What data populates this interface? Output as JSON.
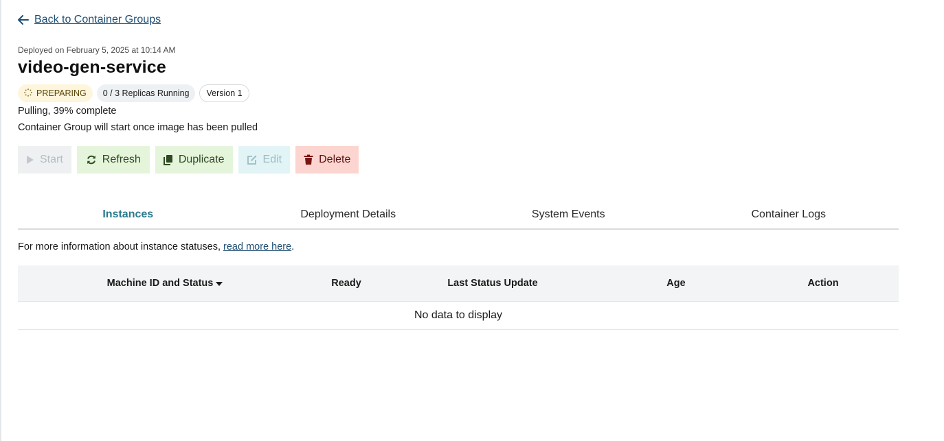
{
  "back_link": {
    "label": "Back to Container Groups"
  },
  "header": {
    "deployed": "Deployed on February 5, 2025 at 10:14 AM",
    "title": "video-gen-service"
  },
  "badges": {
    "status": "PREPARING",
    "replicas": "0 / 3 Replicas Running",
    "version": "Version 1"
  },
  "status_text": {
    "pulling": "Pulling, 39% complete",
    "note": "Container Group will start once image has been pulled"
  },
  "actions": {
    "start": "Start",
    "refresh": "Refresh",
    "duplicate": "Duplicate",
    "edit": "Edit",
    "delete": "Delete"
  },
  "tabs": [
    {
      "label": "Instances",
      "active": true
    },
    {
      "label": "Deployment Details",
      "active": false
    },
    {
      "label": "System Events",
      "active": false
    },
    {
      "label": "Container Logs",
      "active": false
    }
  ],
  "info": {
    "prefix": "For more information about instance statuses, ",
    "link": "read more here",
    "suffix": "."
  },
  "table": {
    "columns": [
      "Machine ID and Status",
      "Ready",
      "Last Status Update",
      "Age",
      "Action"
    ],
    "empty_message": "No data to display"
  },
  "colors": {
    "accent": "#2a7a8f",
    "link": "#1f4e73",
    "preparing_bg": "#fdf6dc",
    "success_bg": "#e5f5dc",
    "danger_bg": "#fdd5d0"
  }
}
